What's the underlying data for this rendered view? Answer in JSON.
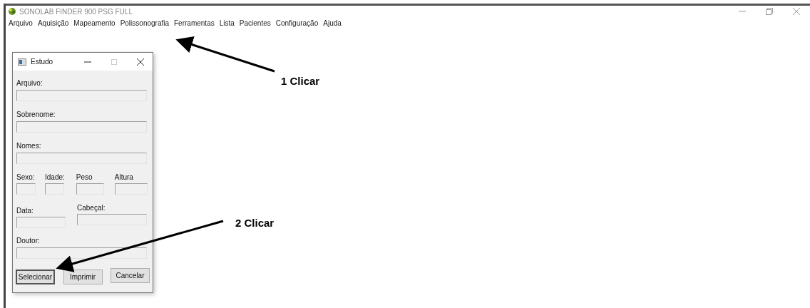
{
  "window": {
    "title": "SONOLAB FINDER 900 PSG FULL"
  },
  "menu": [
    "Arquivo",
    "Aquisição",
    "Mapeamento",
    "Polissonografia",
    "Ferramentas",
    "Lista",
    "Pacientes",
    "Configuração",
    "Ajuda"
  ],
  "dialog": {
    "title": "Estudo",
    "fields": [
      {
        "kind": "full",
        "label": "Arquivo:"
      },
      {
        "kind": "full",
        "label": "Sobrenome:"
      },
      {
        "kind": "full",
        "label": "Nomes:"
      },
      {
        "kind": "quad",
        "items": [
          {
            "label": "Sexo:"
          },
          {
            "label": "Idade:"
          },
          {
            "label": "Peso"
          },
          {
            "label": "Altura"
          }
        ]
      },
      {
        "kind": "pair",
        "items": [
          {
            "label": "Data:"
          },
          {
            "label": "Cabeçal:"
          }
        ]
      },
      {
        "kind": "full",
        "label": "Doutor:"
      }
    ],
    "buttons": [
      {
        "label": "Selecionar",
        "default": true
      },
      {
        "label": "Imprimir",
        "default": false
      },
      {
        "label": "Cancelar",
        "default": false
      }
    ]
  },
  "annotations": [
    {
      "text": "1 Clicar"
    },
    {
      "text": "2 Clicar"
    }
  ]
}
